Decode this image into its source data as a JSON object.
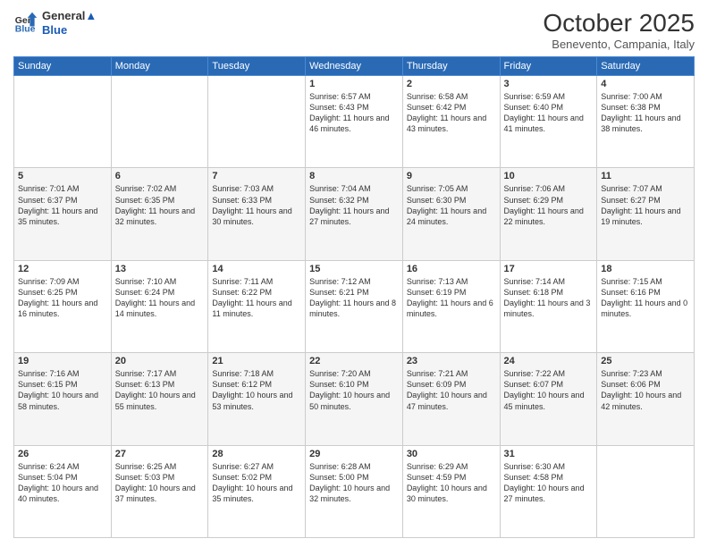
{
  "header": {
    "logo_line1": "General",
    "logo_line2": "Blue",
    "month": "October 2025",
    "location": "Benevento, Campania, Italy"
  },
  "days_of_week": [
    "Sunday",
    "Monday",
    "Tuesday",
    "Wednesday",
    "Thursday",
    "Friday",
    "Saturday"
  ],
  "weeks": [
    [
      {
        "day": "",
        "content": ""
      },
      {
        "day": "",
        "content": ""
      },
      {
        "day": "",
        "content": ""
      },
      {
        "day": "1",
        "content": "Sunrise: 6:57 AM\nSunset: 6:43 PM\nDaylight: 11 hours\nand 46 minutes."
      },
      {
        "day": "2",
        "content": "Sunrise: 6:58 AM\nSunset: 6:42 PM\nDaylight: 11 hours\nand 43 minutes."
      },
      {
        "day": "3",
        "content": "Sunrise: 6:59 AM\nSunset: 6:40 PM\nDaylight: 11 hours\nand 41 minutes."
      },
      {
        "day": "4",
        "content": "Sunrise: 7:00 AM\nSunset: 6:38 PM\nDaylight: 11 hours\nand 38 minutes."
      }
    ],
    [
      {
        "day": "5",
        "content": "Sunrise: 7:01 AM\nSunset: 6:37 PM\nDaylight: 11 hours\nand 35 minutes."
      },
      {
        "day": "6",
        "content": "Sunrise: 7:02 AM\nSunset: 6:35 PM\nDaylight: 11 hours\nand 32 minutes."
      },
      {
        "day": "7",
        "content": "Sunrise: 7:03 AM\nSunset: 6:33 PM\nDaylight: 11 hours\nand 30 minutes."
      },
      {
        "day": "8",
        "content": "Sunrise: 7:04 AM\nSunset: 6:32 PM\nDaylight: 11 hours\nand 27 minutes."
      },
      {
        "day": "9",
        "content": "Sunrise: 7:05 AM\nSunset: 6:30 PM\nDaylight: 11 hours\nand 24 minutes."
      },
      {
        "day": "10",
        "content": "Sunrise: 7:06 AM\nSunset: 6:29 PM\nDaylight: 11 hours\nand 22 minutes."
      },
      {
        "day": "11",
        "content": "Sunrise: 7:07 AM\nSunset: 6:27 PM\nDaylight: 11 hours\nand 19 minutes."
      }
    ],
    [
      {
        "day": "12",
        "content": "Sunrise: 7:09 AM\nSunset: 6:25 PM\nDaylight: 11 hours\nand 16 minutes."
      },
      {
        "day": "13",
        "content": "Sunrise: 7:10 AM\nSunset: 6:24 PM\nDaylight: 11 hours\nand 14 minutes."
      },
      {
        "day": "14",
        "content": "Sunrise: 7:11 AM\nSunset: 6:22 PM\nDaylight: 11 hours\nand 11 minutes."
      },
      {
        "day": "15",
        "content": "Sunrise: 7:12 AM\nSunset: 6:21 PM\nDaylight: 11 hours\nand 8 minutes."
      },
      {
        "day": "16",
        "content": "Sunrise: 7:13 AM\nSunset: 6:19 PM\nDaylight: 11 hours\nand 6 minutes."
      },
      {
        "day": "17",
        "content": "Sunrise: 7:14 AM\nSunset: 6:18 PM\nDaylight: 11 hours\nand 3 minutes."
      },
      {
        "day": "18",
        "content": "Sunrise: 7:15 AM\nSunset: 6:16 PM\nDaylight: 11 hours\nand 0 minutes."
      }
    ],
    [
      {
        "day": "19",
        "content": "Sunrise: 7:16 AM\nSunset: 6:15 PM\nDaylight: 10 hours\nand 58 minutes."
      },
      {
        "day": "20",
        "content": "Sunrise: 7:17 AM\nSunset: 6:13 PM\nDaylight: 10 hours\nand 55 minutes."
      },
      {
        "day": "21",
        "content": "Sunrise: 7:18 AM\nSunset: 6:12 PM\nDaylight: 10 hours\nand 53 minutes."
      },
      {
        "day": "22",
        "content": "Sunrise: 7:20 AM\nSunset: 6:10 PM\nDaylight: 10 hours\nand 50 minutes."
      },
      {
        "day": "23",
        "content": "Sunrise: 7:21 AM\nSunset: 6:09 PM\nDaylight: 10 hours\nand 47 minutes."
      },
      {
        "day": "24",
        "content": "Sunrise: 7:22 AM\nSunset: 6:07 PM\nDaylight: 10 hours\nand 45 minutes."
      },
      {
        "day": "25",
        "content": "Sunrise: 7:23 AM\nSunset: 6:06 PM\nDaylight: 10 hours\nand 42 minutes."
      }
    ],
    [
      {
        "day": "26",
        "content": "Sunrise: 6:24 AM\nSunset: 5:04 PM\nDaylight: 10 hours\nand 40 minutes."
      },
      {
        "day": "27",
        "content": "Sunrise: 6:25 AM\nSunset: 5:03 PM\nDaylight: 10 hours\nand 37 minutes."
      },
      {
        "day": "28",
        "content": "Sunrise: 6:27 AM\nSunset: 5:02 PM\nDaylight: 10 hours\nand 35 minutes."
      },
      {
        "day": "29",
        "content": "Sunrise: 6:28 AM\nSunset: 5:00 PM\nDaylight: 10 hours\nand 32 minutes."
      },
      {
        "day": "30",
        "content": "Sunrise: 6:29 AM\nSunset: 4:59 PM\nDaylight: 10 hours\nand 30 minutes."
      },
      {
        "day": "31",
        "content": "Sunrise: 6:30 AM\nSunset: 4:58 PM\nDaylight: 10 hours\nand 27 minutes."
      },
      {
        "day": "",
        "content": ""
      }
    ]
  ]
}
